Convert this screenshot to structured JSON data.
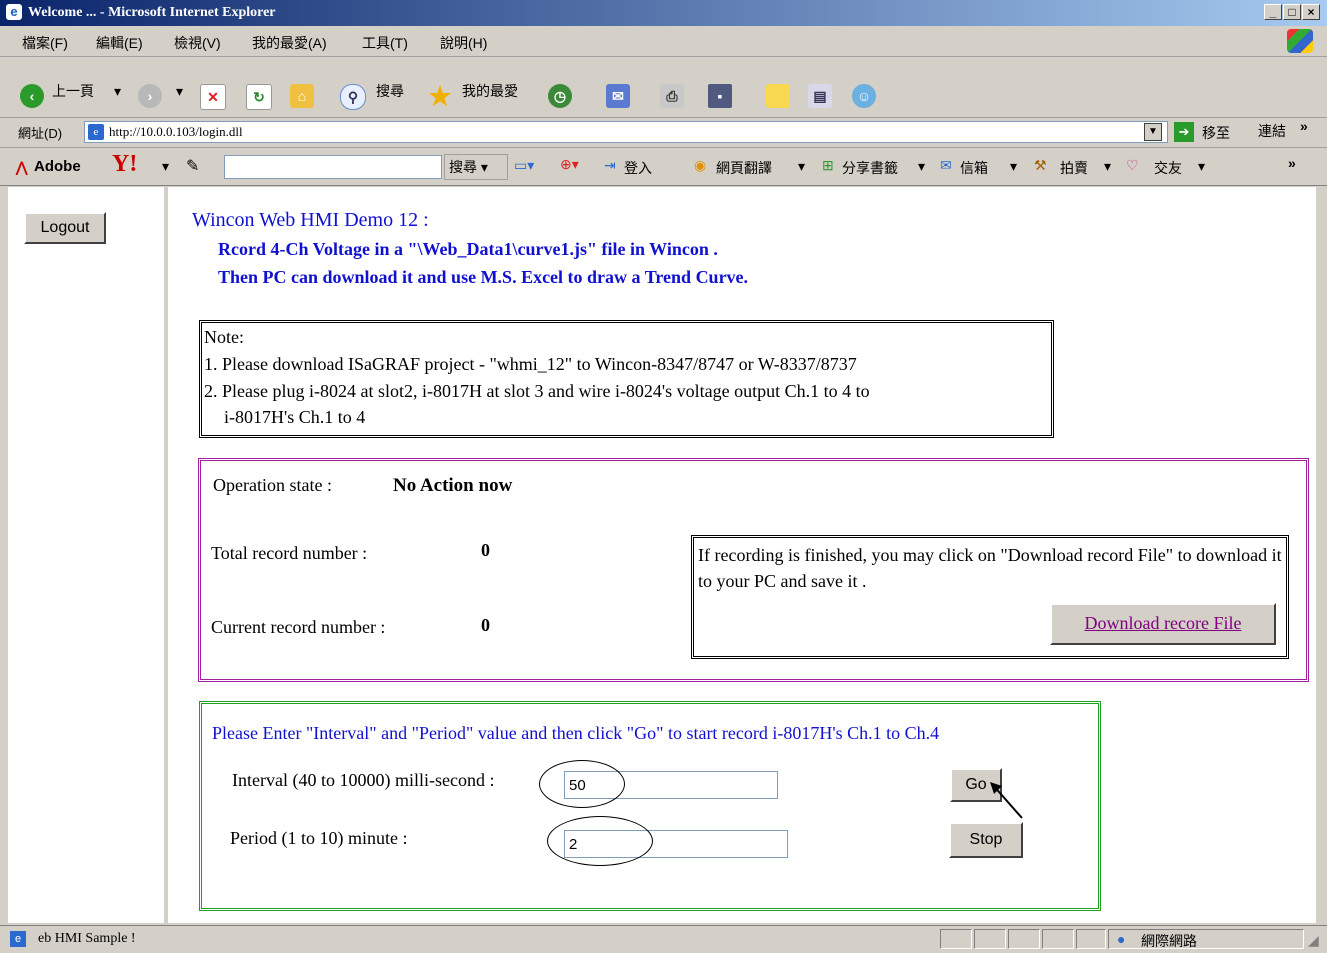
{
  "window": {
    "title": "Welcome ... - Microsoft Internet Explorer"
  },
  "menu": [
    "檔案(F)",
    "編輯(E)",
    "檢視(V)",
    "我的最愛(A)",
    "工具(T)",
    "說明(H)"
  ],
  "toolbar": {
    "back": "上一頁",
    "search": "搜尋",
    "favorites": "我的最愛"
  },
  "address": {
    "label": "網址(D)",
    "url": "http://10.0.0.103/login.dll",
    "go": "移至",
    "links": "連結"
  },
  "yahoo": {
    "adobe": "Adobe",
    "search_btn": "搜尋",
    "login": "登入",
    "translate": "網頁翻譯",
    "share": "分享書籤",
    "mail": "信箱",
    "auction": "拍賣",
    "dating": "交友"
  },
  "left": {
    "logout": "Logout"
  },
  "header": {
    "line1": "Wincon Web HMI Demo 12 :",
    "line2": "Rcord 4-Ch Voltage in a \"\\Web_Data1\\curve1.js\" file in Wincon .",
    "line3": "Then PC can download it and use M.S. Excel to draw a Trend Curve."
  },
  "note": {
    "title": "Note:",
    "line1": "1. Please download ISaGRAF project - \"whmi_12\" to Wincon-8347/8747 or W-8337/8737",
    "line2": "2. Please plug i-8024 at slot2, i-8017H at slot 3 and wire i-8024's voltage output Ch.1 to 4 to",
    "line3": "i-8017H's Ch.1 to 4"
  },
  "status": {
    "op_label": "Operation state :",
    "op_value": "No Action now",
    "total_label": "Total record number :",
    "total_value": "0",
    "current_label": "Current record number :",
    "current_value": "0",
    "download_hint": "If recording is finished, you may click on \"Download record File\" to download it to your PC and save it .",
    "download_btn": "Download recore File"
  },
  "record": {
    "instruction": "Please Enter \"Interval\" and \"Period\" value and then click \"Go\" to start record i-8017H's Ch.1 to Ch.4",
    "interval_label": "Interval  (40 to 10000) milli-second :",
    "interval_value": "50",
    "period_label": "Period (1 to 10) minute :",
    "period_value": "2",
    "go": "Go",
    "stop": "Stop"
  },
  "statusbar": {
    "text": "eb HMI Sample !",
    "zone": "網際網路"
  },
  "colors": {
    "title_blue": "#0a246a",
    "link_blue": "#1010d0",
    "purple_border": "#a020a0",
    "green_border": "#20a020"
  }
}
